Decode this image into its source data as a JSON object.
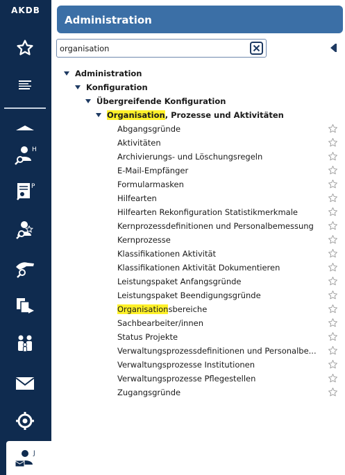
{
  "app": {
    "logo_text": "AKDB"
  },
  "sidebar": {
    "items": [
      {
        "icon": "star-outline-icon"
      },
      {
        "icon": "menu-lines-icon"
      },
      {
        "icon": "collapse-up-icon"
      },
      {
        "icon": "person-search-icon",
        "badge": "H"
      },
      {
        "icon": "document-search-icon",
        "badge": "P"
      },
      {
        "icon": "person-star-icon"
      },
      {
        "icon": "hand-search-icon"
      },
      {
        "icon": "documents-transfer-icon"
      },
      {
        "icon": "family-icon"
      },
      {
        "icon": "mail-icon"
      },
      {
        "icon": "target-icon"
      },
      {
        "icon": "person-mail-icon",
        "badge": "J"
      }
    ],
    "colors": {
      "background": "#0f2b4f",
      "icon": "#ffffff"
    }
  },
  "header": {
    "title": "Administration",
    "color": "#3b6fa6"
  },
  "search": {
    "value": "organisation",
    "placeholder": ""
  },
  "tree": {
    "level1": "Administration",
    "level2": "Konfiguration",
    "level3": "Übergreifende Konfiguration",
    "level4_match": "Organisation",
    "level4_rest": ", Prozesse und Aktivitäten",
    "items": [
      {
        "label": "Abgangsgründe"
      },
      {
        "label": "Aktivitäten"
      },
      {
        "label": "Archivierungs- und Löschungsregeln"
      },
      {
        "label": "E-Mail-Empfänger"
      },
      {
        "label": "Formularmasken"
      },
      {
        "label": "Hilfearten"
      },
      {
        "label": "Hilfearten Rekonfiguration Statistikmerkmale"
      },
      {
        "label": "Kernprozessdefinitionen und Personalbemessung"
      },
      {
        "label": "Kernprozesse"
      },
      {
        "label": "Klassifikationen Aktivität"
      },
      {
        "label": "Klassifikationen Aktivität Dokumentieren"
      },
      {
        "label": "Leistungspaket Anfangsgründe"
      },
      {
        "label": "Leistungspaket Beendigungsgründe"
      },
      {
        "label": "Organisationsbereiche",
        "match": "Organisation",
        "rest": "sbereiche"
      },
      {
        "label": "Sachbearbeiter/innen"
      },
      {
        "label": "Status Projekte"
      },
      {
        "label": "Verwaltungsprozessdefinitionen und Personalbe..."
      },
      {
        "label": "Verwaltungsprozesse Institutionen"
      },
      {
        "label": "Verwaltungsprozesse Pflegestellen"
      },
      {
        "label": "Zugangsgründe"
      }
    ],
    "highlight_color": "#fff12a"
  }
}
